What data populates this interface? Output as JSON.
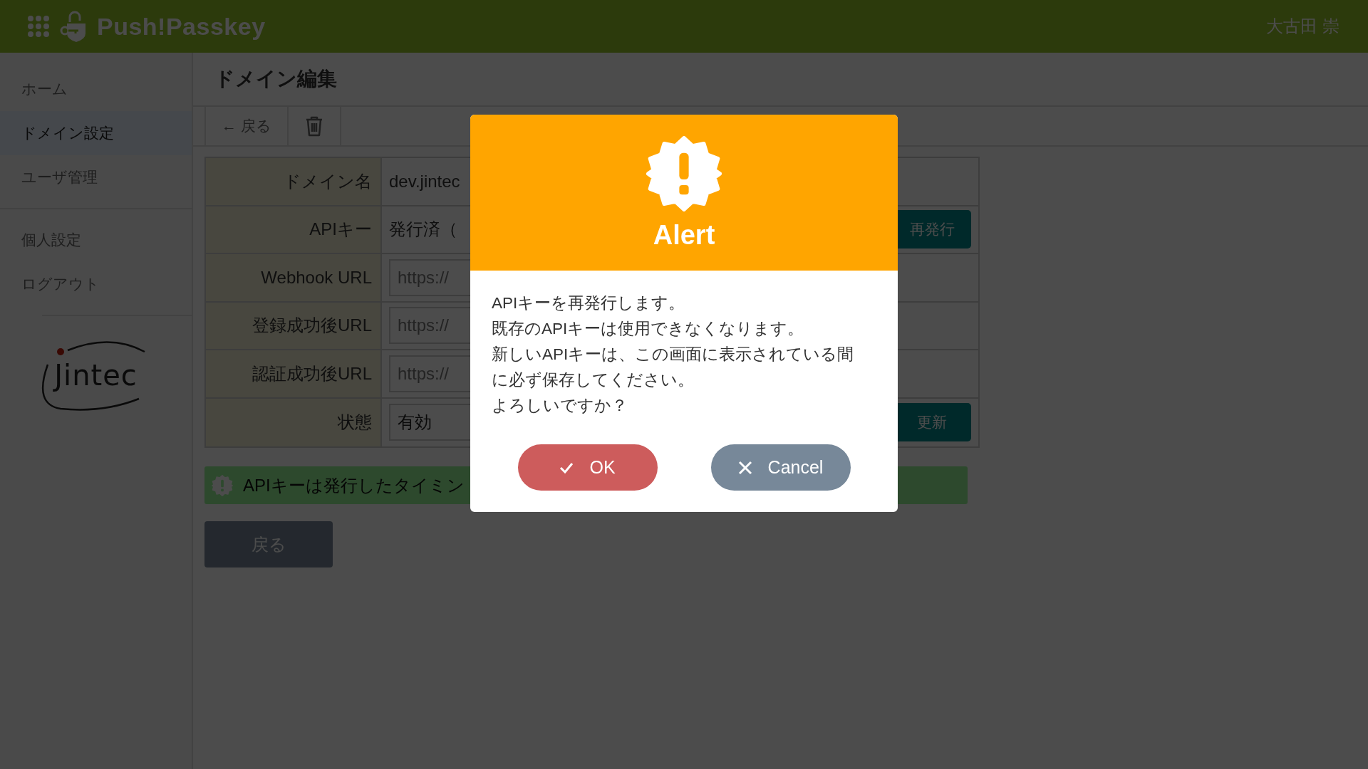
{
  "header": {
    "app_name": "Push!Passkey",
    "user_name": "大古田 崇"
  },
  "sidebar": {
    "sections": [
      {
        "items": [
          {
            "label": "ホーム",
            "selected": false
          },
          {
            "label": "ドメイン設定",
            "selected": true
          },
          {
            "label": "ユーザ管理",
            "selected": false
          }
        ]
      },
      {
        "items": [
          {
            "label": "個人設定",
            "selected": false
          },
          {
            "label": "ログアウト",
            "selected": false
          }
        ]
      }
    ],
    "logo": "Jintec"
  },
  "page": {
    "title": "ドメイン編集",
    "toolbar": {
      "back": "← 戻る"
    },
    "form": [
      {
        "label": "ドメイン名",
        "kind": "text",
        "value": "dev.jintec"
      },
      {
        "label": "APIキー",
        "kind": "text_button",
        "value": "発行済（",
        "button": "再発行"
      },
      {
        "label": "Webhook URL",
        "kind": "input",
        "value": "https://"
      },
      {
        "label": "登録成功後URL",
        "kind": "input",
        "value": "https://"
      },
      {
        "label": "認証成功後URL",
        "kind": "input",
        "value": "https://"
      },
      {
        "label": "状態",
        "kind": "select_button",
        "value": "有効",
        "button": "更新"
      }
    ],
    "notice": "APIキーは発行したタイミン",
    "back_button": "戻る"
  },
  "dialog": {
    "title": "Alert",
    "message": [
      "APIキーを再発行します。",
      "既存のAPIキーは使用できなくなります。",
      "新しいAPIキーは、この画面に表示されている間",
      "に必ず保存してください。",
      "よろしいですか？"
    ],
    "buttons": [
      {
        "kind": "ok",
        "label": "OK"
      },
      {
        "kind": "cancel",
        "label": "Cancel"
      }
    ]
  }
}
